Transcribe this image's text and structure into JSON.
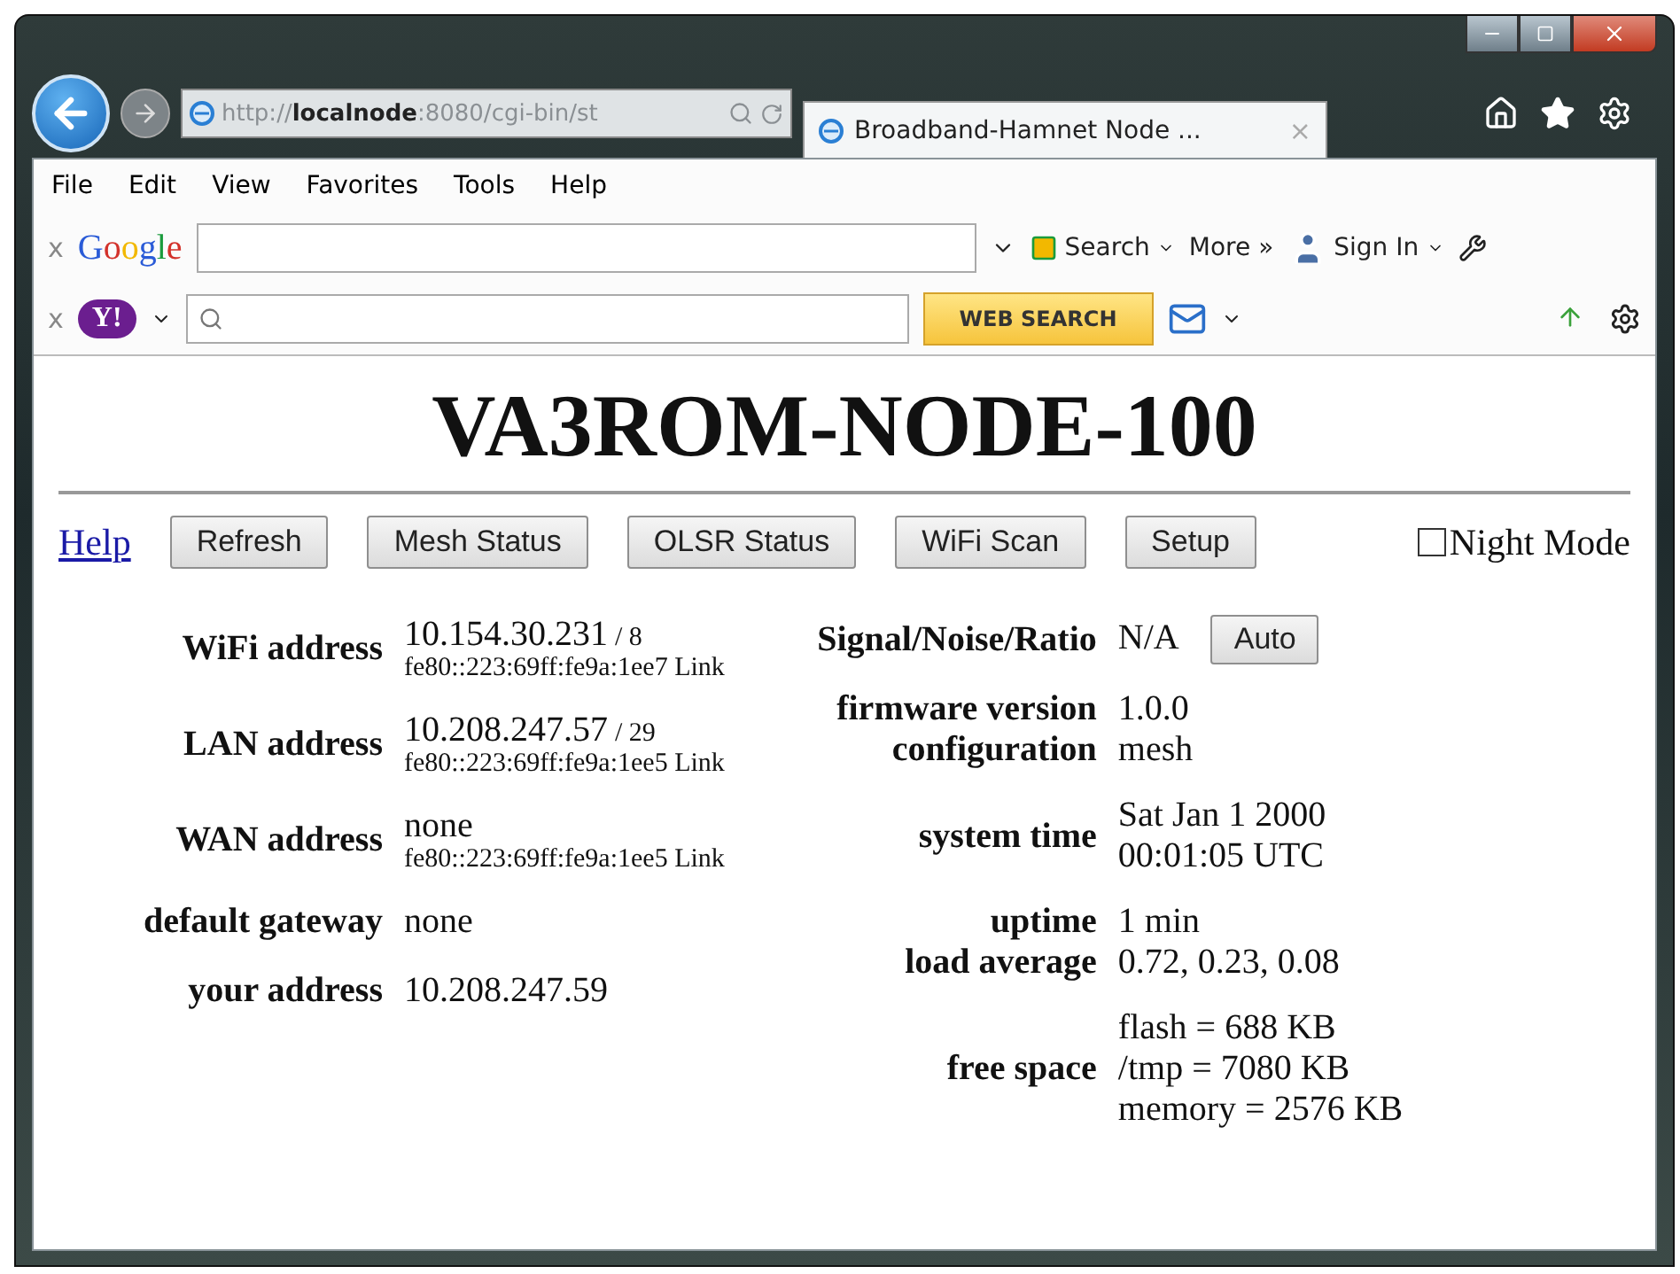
{
  "address_bar": {
    "url": "http://**localnode**:8080/cgi-bin/st"
  },
  "tab": {
    "title": "Broadband-Hamnet Node ...",
    "close": "×"
  },
  "menu": [
    "File",
    "Edit",
    "View",
    "Favorites",
    "Tools",
    "Help"
  ],
  "google_toolbar": {
    "close": "x",
    "logo": "Google",
    "search": "Search",
    "more": "More »",
    "sign_in": "Sign In"
  },
  "yahoo_toolbar": {
    "close": "x",
    "logo": "Y!",
    "button": "WEB SEARCH"
  },
  "page": {
    "title": "VA3ROM-NODE-100",
    "help_link": "Help",
    "buttons": [
      "Refresh",
      "Mesh Status",
      "OLSR Status",
      "WiFi Scan",
      "Setup"
    ],
    "night_mode": {
      "label": "Night Mode",
      "checked": false
    },
    "left_rows": [
      {
        "label": "WiFi address",
        "value": "10.154.30.231",
        "mask": "/ 8",
        "link_local": "fe80::223:69ff:fe9a:1ee7 Link"
      },
      {
        "label": "LAN address",
        "value": "10.208.247.57",
        "mask": "/ 29",
        "link_local": "fe80::223:69ff:fe9a:1ee5 Link"
      },
      {
        "label": "WAN address",
        "value": "none",
        "link_local": "fe80::223:69ff:fe9a:1ee5 Link"
      },
      {
        "label": "default gateway",
        "value": "none"
      },
      {
        "label": "your address",
        "value": "10.208.247.59"
      }
    ],
    "right_groups": [
      [
        {
          "label": "Signal/Noise/Ratio",
          "lines": [
            "N/A"
          ],
          "button": "Auto"
        }
      ],
      [
        {
          "label": "firmware version",
          "lines": [
            "1.0.0"
          ]
        },
        {
          "label": "configuration",
          "lines": [
            "mesh"
          ]
        }
      ],
      [
        {
          "label": "system time",
          "lines": [
            "Sat Jan 1 2000",
            "00:01:05 UTC"
          ]
        }
      ],
      [
        {
          "label": "uptime",
          "lines": [
            "1 min"
          ]
        },
        {
          "label": "load average",
          "lines": [
            "0.72, 0.23, 0.08"
          ]
        }
      ],
      [
        {
          "label": "free space",
          "lines": [
            "flash = 688 KB",
            "/tmp = 7080 KB",
            "memory = 2576 KB"
          ]
        }
      ]
    ]
  }
}
